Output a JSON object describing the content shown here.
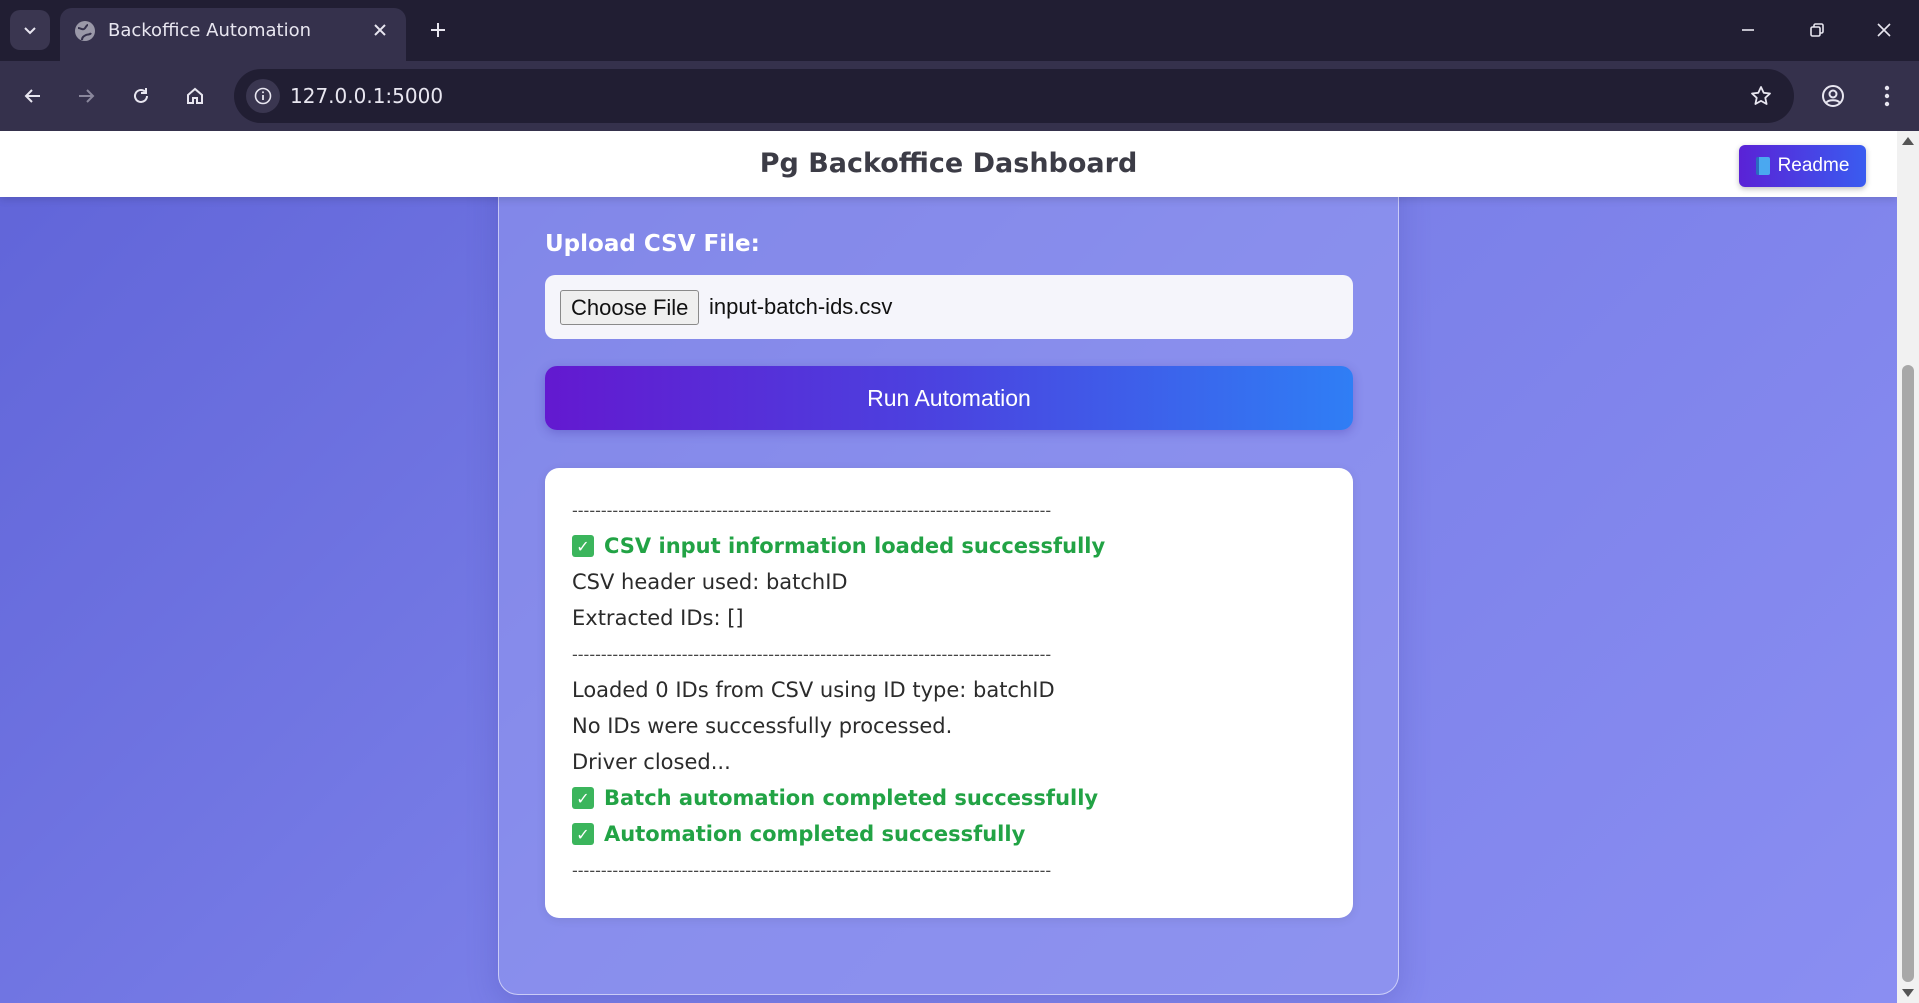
{
  "browser": {
    "tab_title": "Backoffice Automation",
    "url": "127.0.0.1:5000",
    "accent": "#211e33"
  },
  "header": {
    "title": "Pg Backoffice Dashboard",
    "readme_label": "Readme",
    "readme_icon": "book-icon"
  },
  "form": {
    "upload_label": "Upload CSV File:",
    "choose_button_label": "Choose File",
    "file_name": "input-batch-ids.csv",
    "run_button_label": "Run Automation"
  },
  "log": {
    "separator": "-----------------------------------------------------------------------------------",
    "lines": [
      {
        "type": "separator"
      },
      {
        "type": "success",
        "text": "CSV input information loaded successfully"
      },
      {
        "type": "text",
        "text": "CSV header used: batchID"
      },
      {
        "type": "text",
        "text": "Extracted IDs: []"
      },
      {
        "type": "separator"
      },
      {
        "type": "text",
        "text": "Loaded 0 IDs from CSV using ID type: batchID"
      },
      {
        "type": "text",
        "text": "No IDs were successfully processed."
      },
      {
        "type": "text",
        "text": "Driver closed..."
      },
      {
        "type": "success",
        "text": "Batch automation completed successfully"
      },
      {
        "type": "success",
        "text": "Automation completed successfully"
      },
      {
        "type": "separator"
      }
    ],
    "success_color": "#22a345"
  }
}
